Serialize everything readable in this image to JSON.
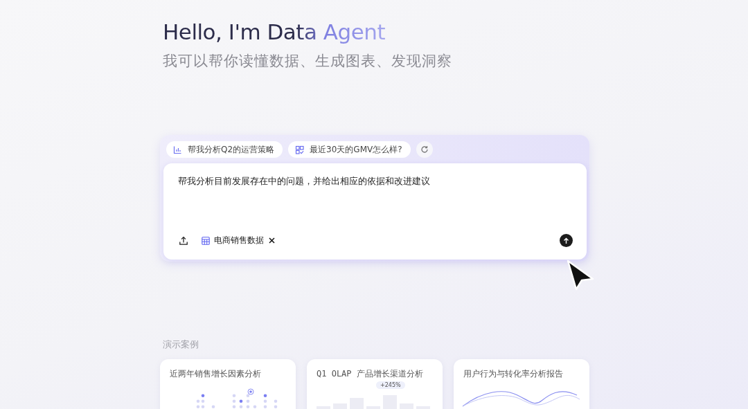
{
  "header": {
    "title": "Hello, I'm Data Agent",
    "subtitle": "我可以帮你读懂数据、生成图表、发现洞察"
  },
  "composer": {
    "suggestions": [
      {
        "kind": "chart",
        "label": "帮我分析Q2的运营策略"
      },
      {
        "kind": "grid",
        "label": "最近30天的GMV怎么样?"
      }
    ],
    "prompt": "帮我分析目前发展存在中的问题，并给出相应的依据和改进建议",
    "attachments": [
      {
        "label": "电商销售数据"
      }
    ]
  },
  "cases": {
    "heading": "演示案例",
    "items": [
      {
        "kind": "dots",
        "title": "近两年销售增长因素分析"
      },
      {
        "kind": "bars",
        "title": "Q1 OLAP 产品增长渠道分析",
        "badge": "+245%"
      },
      {
        "kind": "waves",
        "title": "用户行为与转化率分析报告"
      }
    ]
  }
}
